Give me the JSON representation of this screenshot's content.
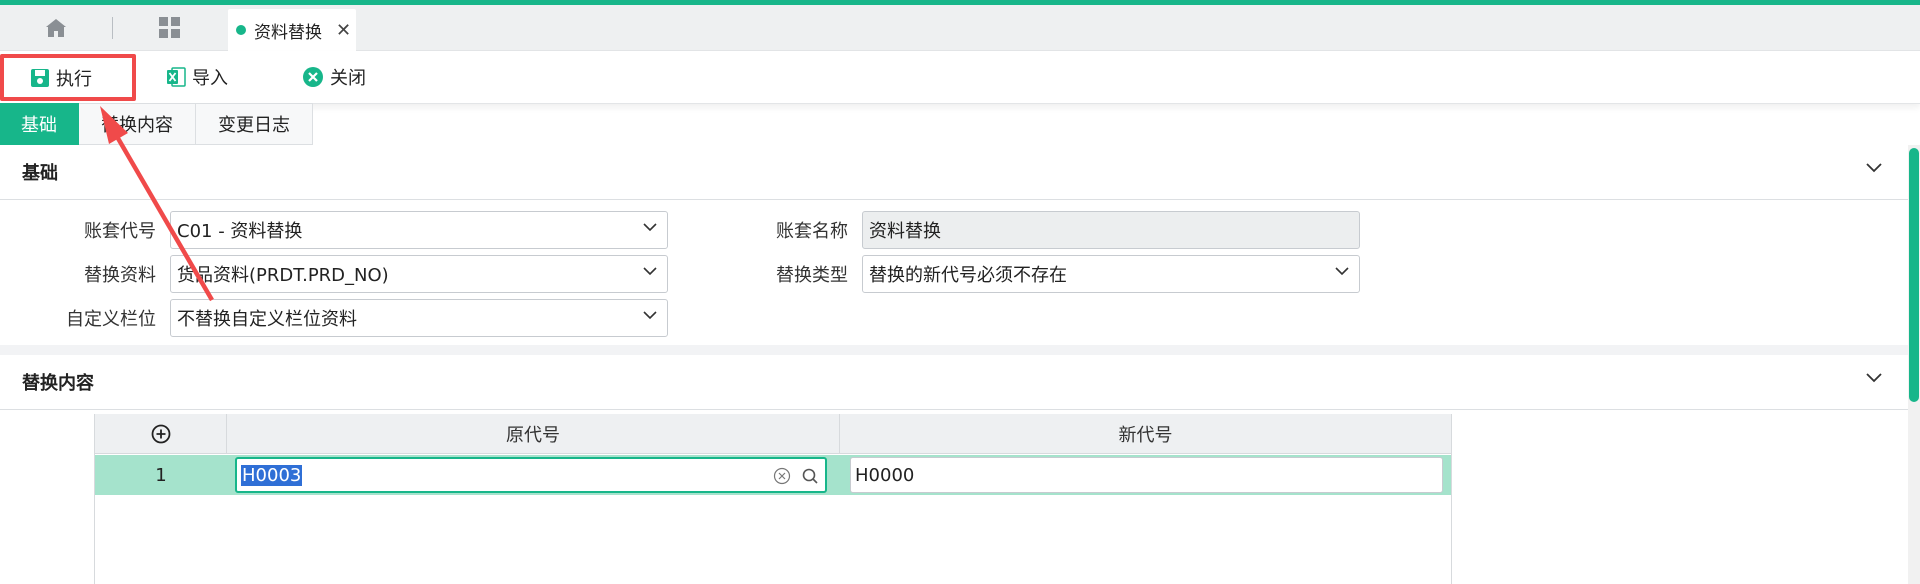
{
  "tabbar": {
    "doc_tab_label": "资料替换"
  },
  "toolbar": {
    "execute": "执行",
    "import": "导入",
    "close": "关闭"
  },
  "subtabs": [
    "基础",
    "替换内容",
    "变更日志"
  ],
  "section_basic": {
    "title": "基础",
    "fields": {
      "account_code_label": "账套代号",
      "account_code_value": "C01 - 资料替换",
      "account_name_label": "账套名称",
      "account_name_value": "资料替换",
      "replace_data_label": "替换资料",
      "replace_data_value": "货品资料(PRDT.PRD_NO)",
      "replace_type_label": "替换类型",
      "replace_type_value": "替换的新代号必须不存在",
      "custom_field_label": "自定义栏位",
      "custom_field_value": "不替换自定义栏位资料"
    }
  },
  "section_replace": {
    "title": "替换内容",
    "columns": [
      "原代号",
      "新代号"
    ],
    "rows": [
      {
        "index": "1",
        "old_code": "H0003",
        "new_code": "H0000"
      }
    ]
  },
  "colors": {
    "accent": "#17b68a",
    "highlight_box": "#f04a4a",
    "row_selected": "#a5e3cc"
  }
}
